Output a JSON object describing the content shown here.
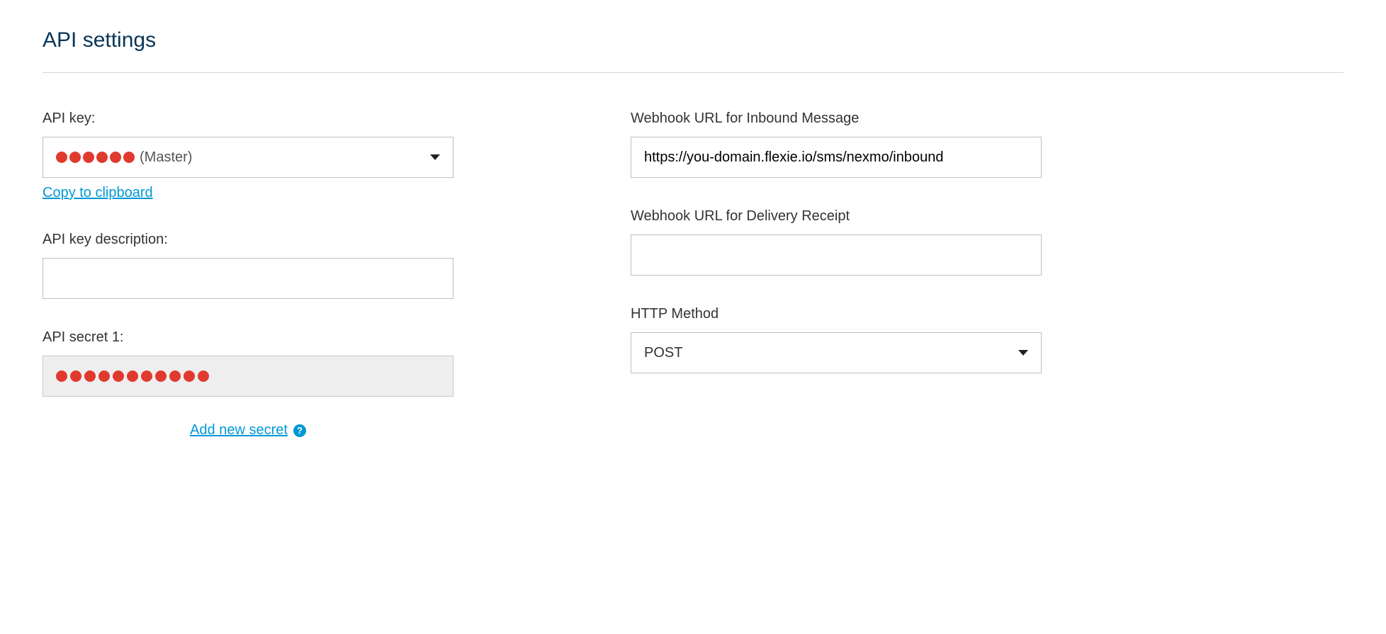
{
  "page": {
    "title": "API settings"
  },
  "left": {
    "api_key_label": "API key:",
    "api_key_suffix": "(Master)",
    "copy_link": "Copy to clipboard",
    "desc_label": "API key description:",
    "desc_value": "",
    "secret_label": "API secret 1:",
    "add_secret": "Add new secret"
  },
  "right": {
    "inbound_label": "Webhook URL for Inbound Message",
    "inbound_value": "https://you-domain.flexie.io/sms/nexmo/inbound",
    "delivery_label": "Webhook URL for Delivery Receipt",
    "delivery_value": "",
    "http_label": "HTTP Method",
    "http_value": "POST"
  }
}
